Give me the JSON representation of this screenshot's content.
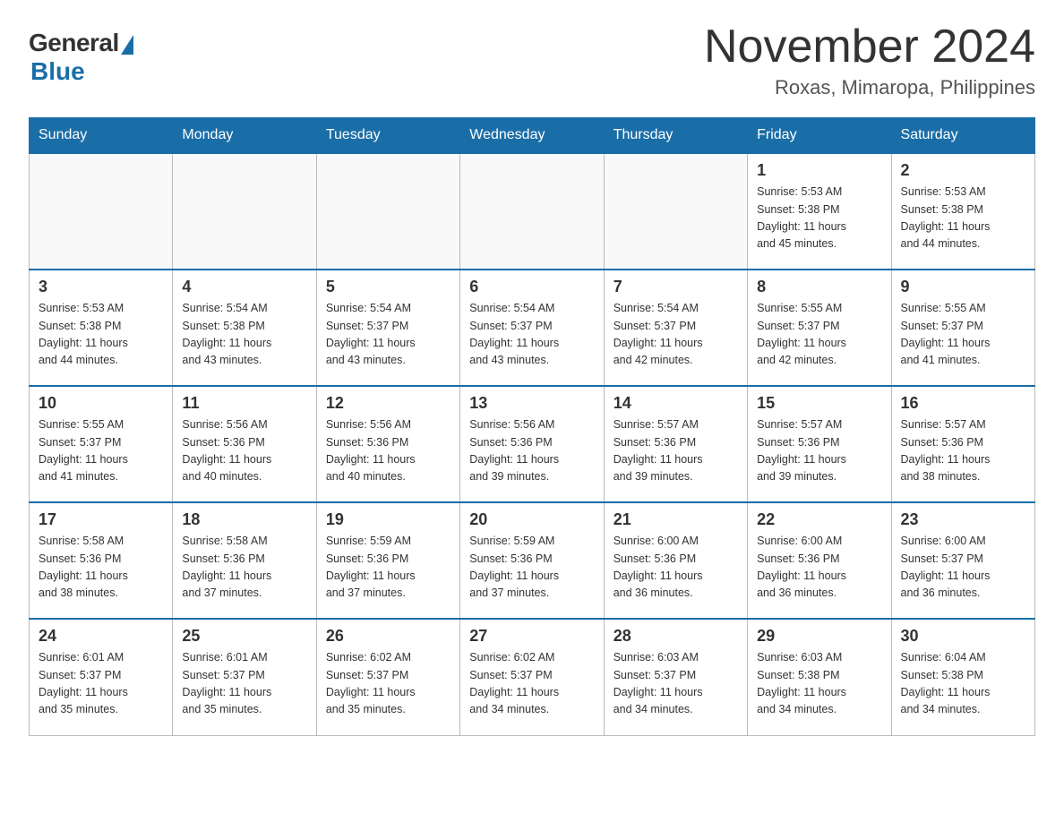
{
  "header": {
    "logo_general": "General",
    "logo_blue": "Blue",
    "month_title": "November 2024",
    "location": "Roxas, Mimaropa, Philippines"
  },
  "weekdays": [
    "Sunday",
    "Monday",
    "Tuesday",
    "Wednesday",
    "Thursday",
    "Friday",
    "Saturday"
  ],
  "weeks": [
    [
      {
        "day": "",
        "info": ""
      },
      {
        "day": "",
        "info": ""
      },
      {
        "day": "",
        "info": ""
      },
      {
        "day": "",
        "info": ""
      },
      {
        "day": "",
        "info": ""
      },
      {
        "day": "1",
        "info": "Sunrise: 5:53 AM\nSunset: 5:38 PM\nDaylight: 11 hours\nand 45 minutes."
      },
      {
        "day": "2",
        "info": "Sunrise: 5:53 AM\nSunset: 5:38 PM\nDaylight: 11 hours\nand 44 minutes."
      }
    ],
    [
      {
        "day": "3",
        "info": "Sunrise: 5:53 AM\nSunset: 5:38 PM\nDaylight: 11 hours\nand 44 minutes."
      },
      {
        "day": "4",
        "info": "Sunrise: 5:54 AM\nSunset: 5:38 PM\nDaylight: 11 hours\nand 43 minutes."
      },
      {
        "day": "5",
        "info": "Sunrise: 5:54 AM\nSunset: 5:37 PM\nDaylight: 11 hours\nand 43 minutes."
      },
      {
        "day": "6",
        "info": "Sunrise: 5:54 AM\nSunset: 5:37 PM\nDaylight: 11 hours\nand 43 minutes."
      },
      {
        "day": "7",
        "info": "Sunrise: 5:54 AM\nSunset: 5:37 PM\nDaylight: 11 hours\nand 42 minutes."
      },
      {
        "day": "8",
        "info": "Sunrise: 5:55 AM\nSunset: 5:37 PM\nDaylight: 11 hours\nand 42 minutes."
      },
      {
        "day": "9",
        "info": "Sunrise: 5:55 AM\nSunset: 5:37 PM\nDaylight: 11 hours\nand 41 minutes."
      }
    ],
    [
      {
        "day": "10",
        "info": "Sunrise: 5:55 AM\nSunset: 5:37 PM\nDaylight: 11 hours\nand 41 minutes."
      },
      {
        "day": "11",
        "info": "Sunrise: 5:56 AM\nSunset: 5:36 PM\nDaylight: 11 hours\nand 40 minutes."
      },
      {
        "day": "12",
        "info": "Sunrise: 5:56 AM\nSunset: 5:36 PM\nDaylight: 11 hours\nand 40 minutes."
      },
      {
        "day": "13",
        "info": "Sunrise: 5:56 AM\nSunset: 5:36 PM\nDaylight: 11 hours\nand 39 minutes."
      },
      {
        "day": "14",
        "info": "Sunrise: 5:57 AM\nSunset: 5:36 PM\nDaylight: 11 hours\nand 39 minutes."
      },
      {
        "day": "15",
        "info": "Sunrise: 5:57 AM\nSunset: 5:36 PM\nDaylight: 11 hours\nand 39 minutes."
      },
      {
        "day": "16",
        "info": "Sunrise: 5:57 AM\nSunset: 5:36 PM\nDaylight: 11 hours\nand 38 minutes."
      }
    ],
    [
      {
        "day": "17",
        "info": "Sunrise: 5:58 AM\nSunset: 5:36 PM\nDaylight: 11 hours\nand 38 minutes."
      },
      {
        "day": "18",
        "info": "Sunrise: 5:58 AM\nSunset: 5:36 PM\nDaylight: 11 hours\nand 37 minutes."
      },
      {
        "day": "19",
        "info": "Sunrise: 5:59 AM\nSunset: 5:36 PM\nDaylight: 11 hours\nand 37 minutes."
      },
      {
        "day": "20",
        "info": "Sunrise: 5:59 AM\nSunset: 5:36 PM\nDaylight: 11 hours\nand 37 minutes."
      },
      {
        "day": "21",
        "info": "Sunrise: 6:00 AM\nSunset: 5:36 PM\nDaylight: 11 hours\nand 36 minutes."
      },
      {
        "day": "22",
        "info": "Sunrise: 6:00 AM\nSunset: 5:36 PM\nDaylight: 11 hours\nand 36 minutes."
      },
      {
        "day": "23",
        "info": "Sunrise: 6:00 AM\nSunset: 5:37 PM\nDaylight: 11 hours\nand 36 minutes."
      }
    ],
    [
      {
        "day": "24",
        "info": "Sunrise: 6:01 AM\nSunset: 5:37 PM\nDaylight: 11 hours\nand 35 minutes."
      },
      {
        "day": "25",
        "info": "Sunrise: 6:01 AM\nSunset: 5:37 PM\nDaylight: 11 hours\nand 35 minutes."
      },
      {
        "day": "26",
        "info": "Sunrise: 6:02 AM\nSunset: 5:37 PM\nDaylight: 11 hours\nand 35 minutes."
      },
      {
        "day": "27",
        "info": "Sunrise: 6:02 AM\nSunset: 5:37 PM\nDaylight: 11 hours\nand 34 minutes."
      },
      {
        "day": "28",
        "info": "Sunrise: 6:03 AM\nSunset: 5:37 PM\nDaylight: 11 hours\nand 34 minutes."
      },
      {
        "day": "29",
        "info": "Sunrise: 6:03 AM\nSunset: 5:38 PM\nDaylight: 11 hours\nand 34 minutes."
      },
      {
        "day": "30",
        "info": "Sunrise: 6:04 AM\nSunset: 5:38 PM\nDaylight: 11 hours\nand 34 minutes."
      }
    ]
  ]
}
